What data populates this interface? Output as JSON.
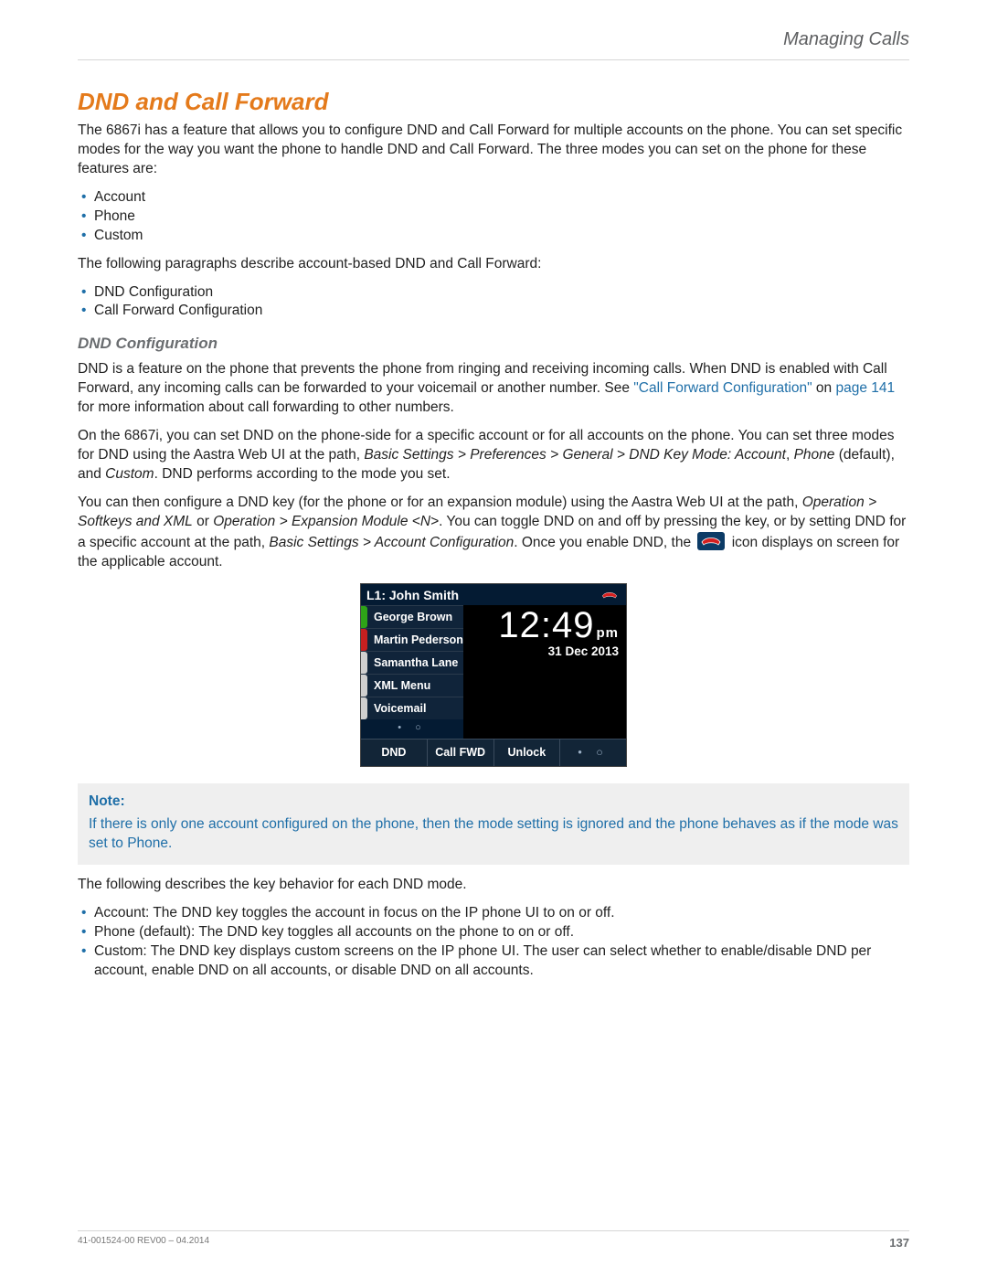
{
  "header": {
    "section": "Managing Calls"
  },
  "h2": "DND and Call Forward",
  "intro": "The 6867i has a feature that allows you to configure DND and Call Forward for multiple accounts on the phone. You can set specific modes for the way you want the phone to handle DND and Call Forward. The three modes you can set on the phone for these features are:",
  "modes": [
    "Account",
    "Phone",
    "Custom"
  ],
  "intro2": "The following paragraphs describe account-based DND and Call Forward:",
  "configs": [
    "DND Configuration",
    "Call Forward Configuration"
  ],
  "h3": "DND Configuration",
  "p1_a": "DND is a feature on the phone that prevents the phone from ringing and receiving incoming calls. When DND is enabled with Call Forward, any incoming calls can be forwarded to your voicemail or another number. See ",
  "p1_link": "\"Call Forward Configuration\"",
  "p1_b": " on ",
  "p1_page": "page 141",
  "p1_c": " for more information about call forwarding to other numbers.",
  "p2_a": "On the 6867i, you can set DND on the phone-side for a specific account or for all accounts on the phone. You can set three modes for DND using the Aastra Web UI at the path, ",
  "p2_path": "Basic Settings > Preferences > General > DND Key Mode: Account",
  "p2_b": ", ",
  "p2_phone": "Phone",
  "p2_c": " (default), and ",
  "p2_custom": "Custom",
  "p2_d": ". DND performs according to the mode you set.",
  "p3_a": "You can then configure a DND key (for the phone or for an expansion module) using the Aastra Web UI at the path, ",
  "p3_path1": "Operation > Softkeys and XML",
  "p3_b": " or ",
  "p3_path2": "Operation > Expansion Module <N>",
  "p3_c": ". You can toggle DND on and off by pressing the key, or by setting DND for a specific account at the path, ",
  "p3_path3": "Basic Settings > Account Configuration",
  "p3_d": ". Once you enable DND, the ",
  "p3_e": " icon displays on screen for the applicable account.",
  "phone": {
    "line": "L1: John Smith",
    "keys": [
      {
        "label": "George Brown",
        "color": "#2ea318"
      },
      {
        "label": "Martin Pederson",
        "color": "#c62020"
      },
      {
        "label": "Samantha Lane",
        "color": "#cfcfcf"
      },
      {
        "label": "XML Menu",
        "color": "#cfcfcf"
      },
      {
        "label": "Voicemail",
        "color": "#cfcfcf"
      }
    ],
    "time": "12:49",
    "ampm": "pm",
    "date": "31 Dec 2013",
    "dots_top": "•  ○",
    "soft": [
      "DND",
      "Call FWD",
      "Unlock",
      "•  ○"
    ]
  },
  "note": {
    "hdr": "Note:",
    "body": "If there is only one account configured on the phone, then the mode setting is ignored and the phone behaves as if the mode was set to Phone."
  },
  "p4": "The following describes the key behavior for each DND mode.",
  "behaviors": [
    "Account: The DND key toggles the account in focus on the IP phone UI to on or off.",
    "Phone (default): The DND key toggles all accounts on the phone to on or off.",
    "Custom: The DND key displays custom screens on the IP phone UI. The user can select whether to enable/disable DND per account, enable DND on all accounts, or disable DND on all accounts."
  ],
  "footer": {
    "doc": "41-001524-00 REV00 – 04.2014",
    "page": "137"
  }
}
